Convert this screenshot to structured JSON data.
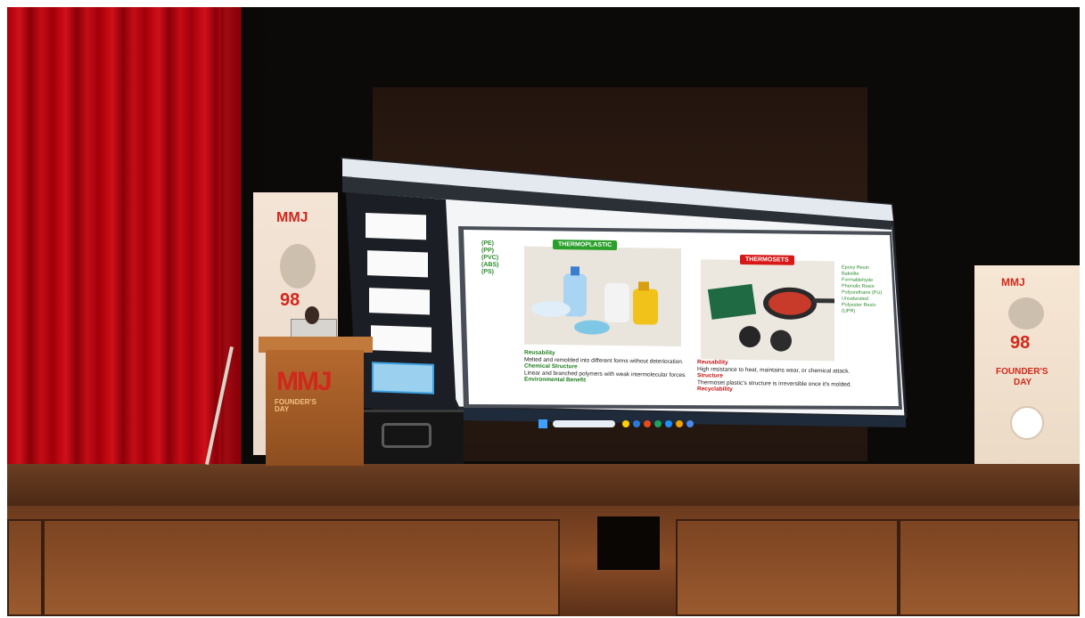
{
  "slide": {
    "thermoplastic_label": "THERMOPLASTIC",
    "thermoset_label": "THERMOSETS",
    "abbreviations": [
      "(PE)",
      "(PP)",
      "(PVC)",
      "(ABS)",
      "(PS)"
    ],
    "left_points": [
      {
        "heading": "Reusability",
        "text": "Melted and remolded into different forms without deterioration."
      },
      {
        "heading": "Chemical Structure",
        "text": "Linear and branched polymers with weak intermolecular forces."
      },
      {
        "heading": "Environmental Benefit",
        "text": ""
      }
    ],
    "right_points": [
      {
        "heading": "Reusability",
        "text": "High resistance to heat, maintains wear, or chemical attack."
      },
      {
        "heading": "Structure",
        "text": "Thermoset plastic's structure is irreversible once it's molded."
      },
      {
        "heading": "Recyclability",
        "text": ""
      }
    ],
    "right_list": [
      "Epoxy Resin",
      "Bakelite",
      "Formaldehyde",
      "Phenolic Resin",
      "Polyurethane (PU)",
      "Unsaturated",
      "Polyester Resin",
      "(UPR)"
    ]
  },
  "podium": {
    "logo": "MMJ",
    "subtitle_1": "FOUNDER'S",
    "subtitle_2": "DAY"
  },
  "banner_right": {
    "logo": "MMJ",
    "number": "98",
    "line1": "FOUNDER'S",
    "line2": "DAY"
  },
  "banner_left": {
    "logo": "MMJ",
    "number": "98"
  },
  "colors": {
    "curtain": "#c0101a",
    "thermoplastic": "#2aa02a",
    "thermoset": "#d81818",
    "stage": "#7c4422"
  }
}
